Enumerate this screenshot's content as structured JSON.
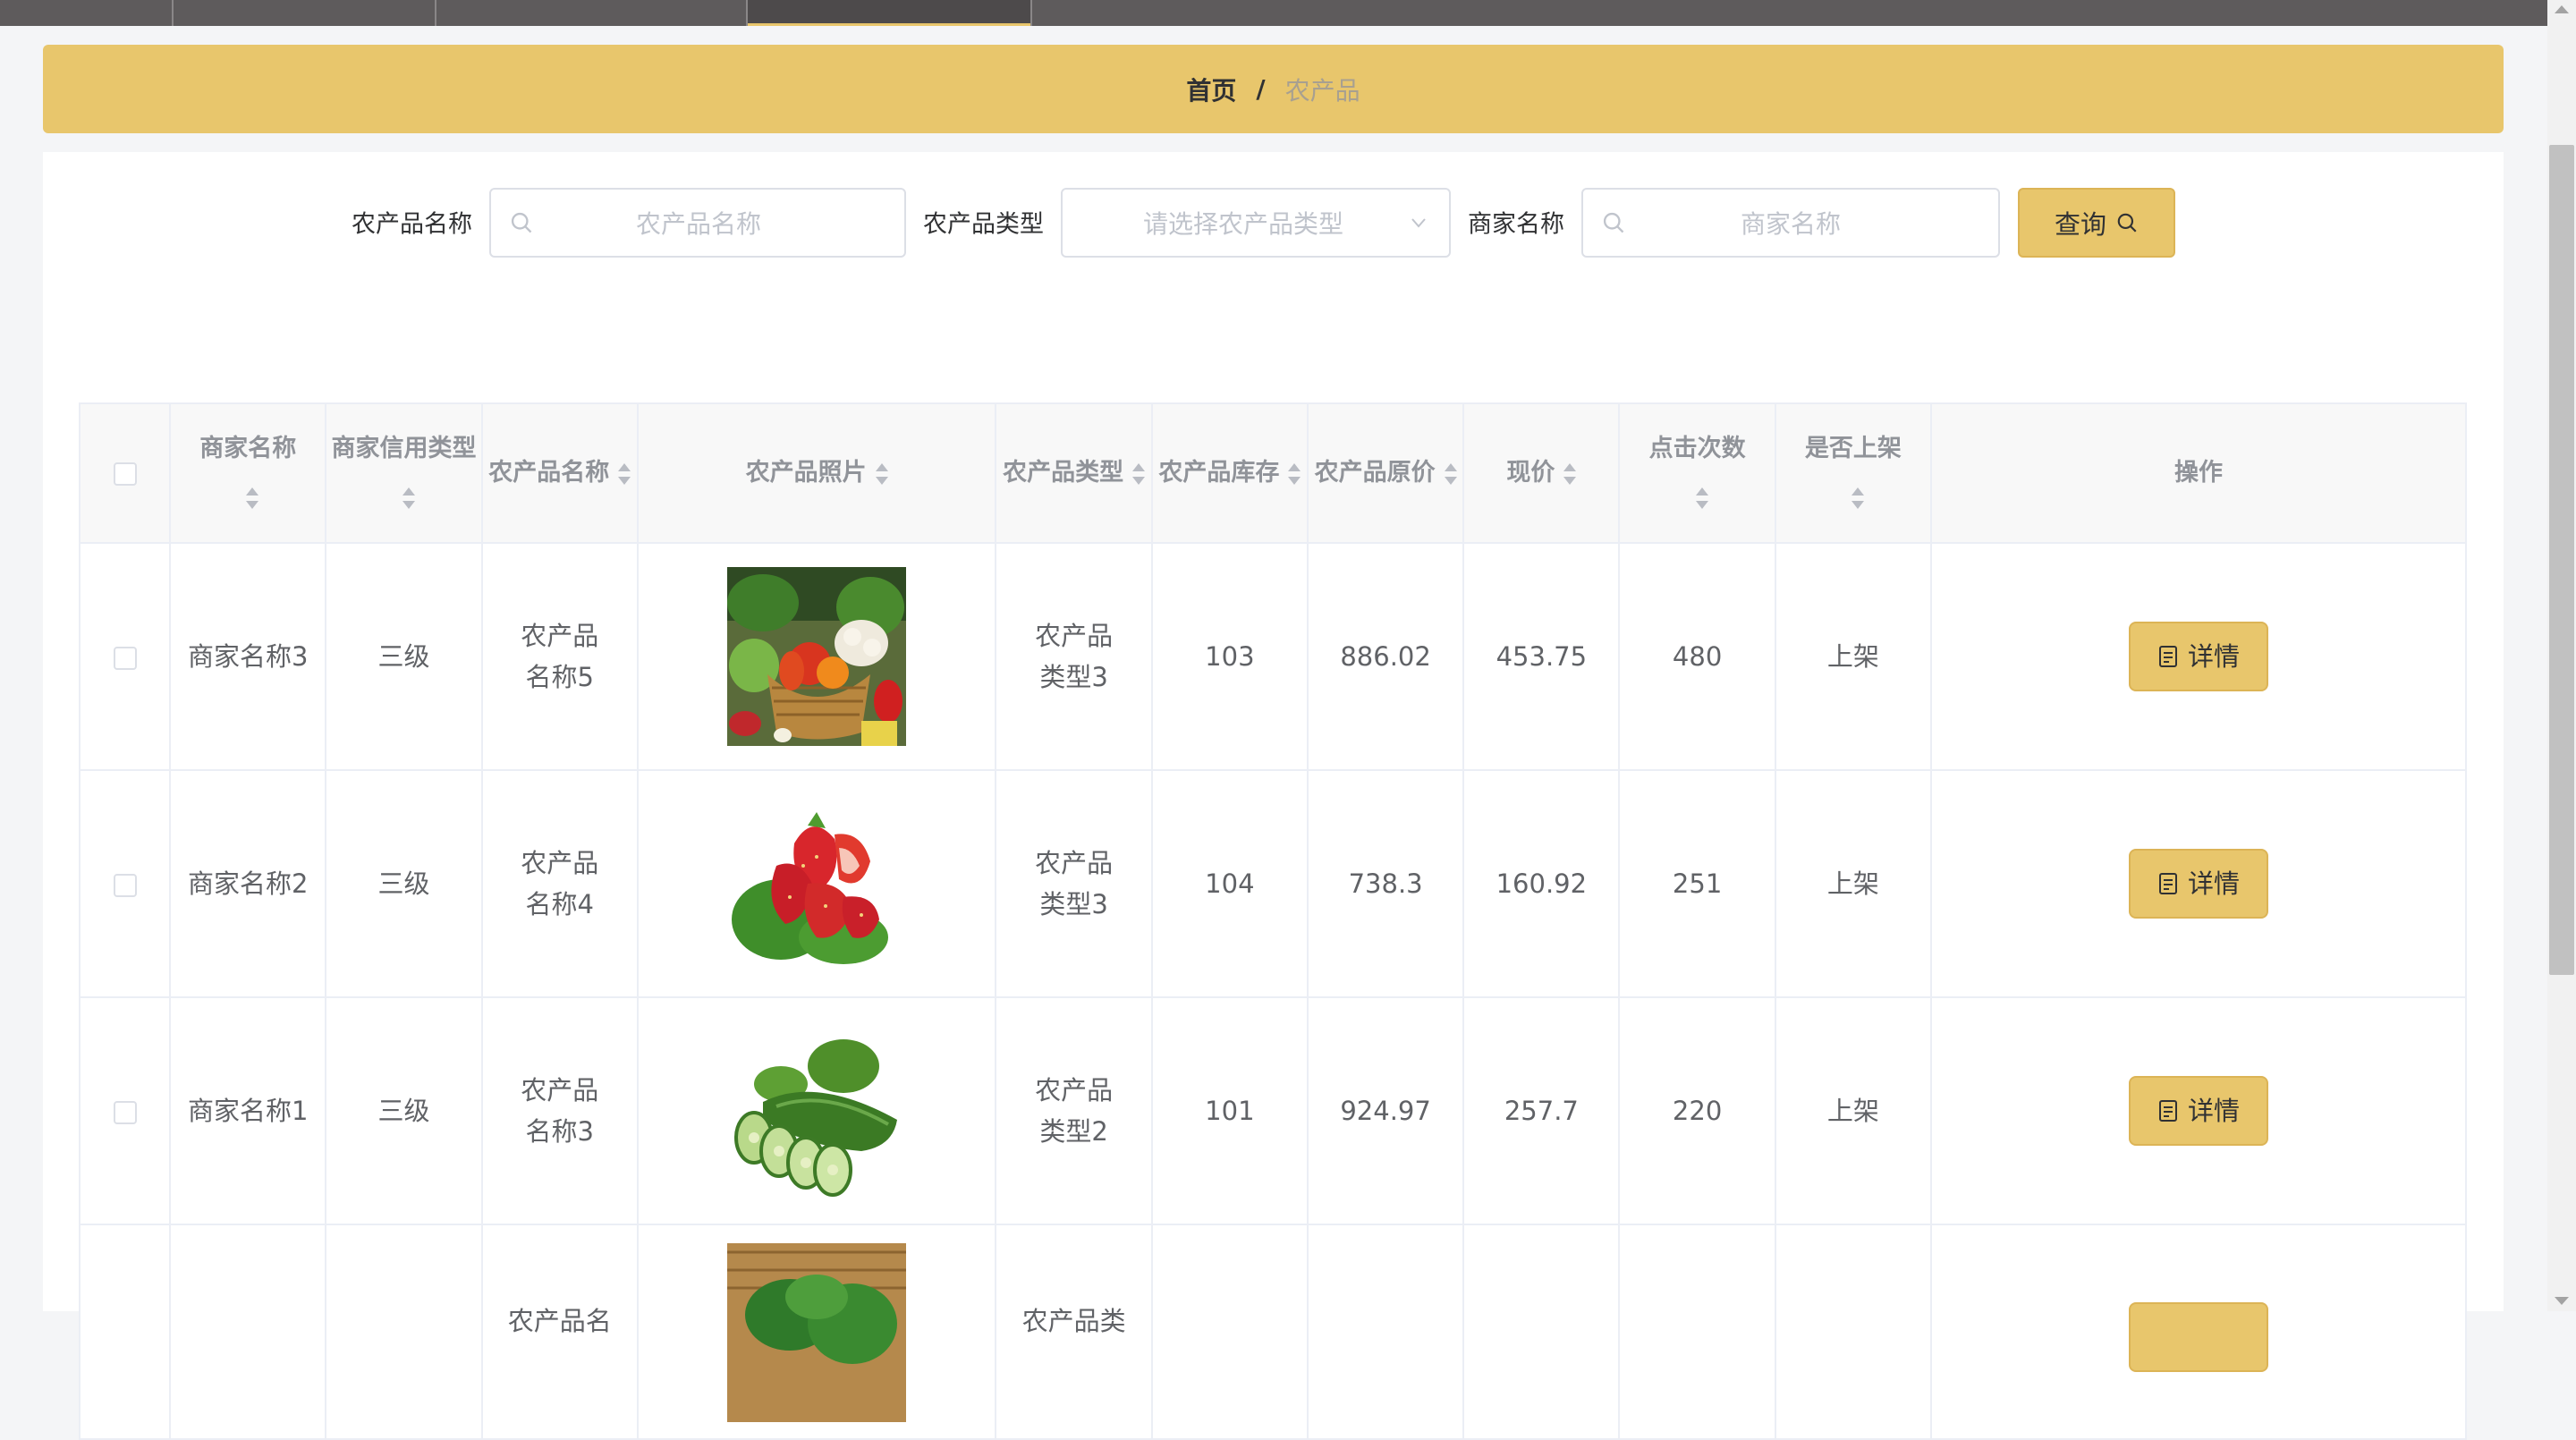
{
  "breadcrumb": {
    "home": "首页",
    "separator": "/",
    "current": "农产品"
  },
  "search": {
    "product_name_label": "农产品名称",
    "product_name_placeholder": "农产品名称",
    "product_type_label": "农产品类型",
    "product_type_placeholder": "请选择农产品类型",
    "merchant_name_label": "商家名称",
    "merchant_name_placeholder": "商家名称",
    "query_label": "查询"
  },
  "table": {
    "headers": {
      "merchant_name": "商家名称",
      "credit_type": "商家信用类型",
      "product_name": "农产品名称",
      "product_photo": "农产品照片",
      "product_type": "农产品类型",
      "stock": "农产品库存",
      "original_price": "农产品原价",
      "current_price": "现价",
      "clicks": "点击次数",
      "on_shelf": "是否上架",
      "actions": "操作"
    },
    "rows": [
      {
        "merchant": "商家名称3",
        "credit": "三级",
        "name": "农产品名称5",
        "photo": "vegetable-basket",
        "type": "农产品类型3",
        "stock": "103",
        "original_price": "886.02",
        "price": "453.75",
        "clicks": "480",
        "on_shelf": "上架",
        "action": "详情"
      },
      {
        "merchant": "商家名称2",
        "credit": "三级",
        "name": "农产品名称4",
        "photo": "strawberries",
        "type": "农产品类型3",
        "stock": "104",
        "original_price": "738.3",
        "price": "160.92",
        "clicks": "251",
        "on_shelf": "上架",
        "action": "详情"
      },
      {
        "merchant": "商家名称1",
        "credit": "三级",
        "name": "农产品名称3",
        "photo": "cucumber",
        "type": "农产品类型2",
        "stock": "101",
        "original_price": "924.97",
        "price": "257.7",
        "clicks": "220",
        "on_shelf": "上架",
        "action": "详情"
      }
    ],
    "partial_row": {
      "name_prefix": "农产品名",
      "type_prefix": "农产品类",
      "photo": "leafy-greens"
    }
  },
  "colors": {
    "accent": "#e8c66c",
    "nav_bg": "#5e5b5c",
    "border": "#ebeef5"
  },
  "icons": {
    "search": "search-icon",
    "dropdown": "chevron-down-icon",
    "detail": "document-icon"
  }
}
